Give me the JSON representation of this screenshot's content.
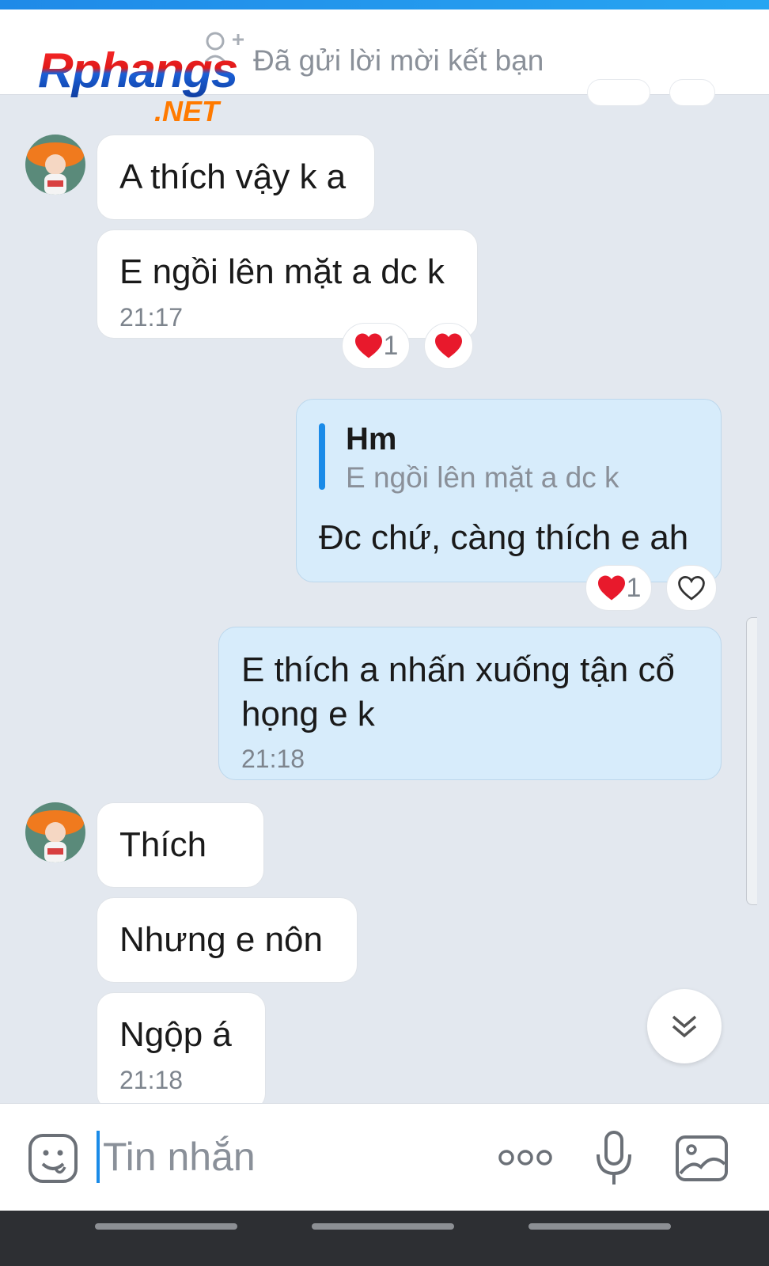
{
  "header": {
    "friend_request_text": "Đã gửi lời mời kết bạn"
  },
  "watermark": {
    "brand": "Rphangs",
    "suffix": ".NET"
  },
  "messages": [
    {
      "sender": "other",
      "text": "A thích vậy k a"
    },
    {
      "sender": "other",
      "text": "E ngồi lên mặt a dc k",
      "time": "21:17",
      "reaction_count": "1"
    },
    {
      "sender": "me",
      "reply_to_name": "Hm",
      "reply_to_text": "E ngồi lên mặt a dc k",
      "text": "Đc chứ, càng thích e ah",
      "reaction_count": "1"
    },
    {
      "sender": "me",
      "text_line1": "E thích a nhấn xuống tận cổ",
      "text_line2": "họng e k",
      "time": "21:18"
    },
    {
      "sender": "other",
      "text": "Thích"
    },
    {
      "sender": "other",
      "text": "Nhưng e nôn"
    },
    {
      "sender": "other",
      "text": "Ngộp á",
      "time": "21:18"
    }
  ],
  "input": {
    "placeholder": "Tin nhắn"
  },
  "icons": {
    "heart_filled": "heart-filled-icon",
    "heart_outline": "heart-outline-icon",
    "scroll_down": "double-chevron-down-icon",
    "emoji": "sticker-icon",
    "more": "more-icon",
    "mic": "microphone-icon",
    "image": "image-icon"
  },
  "colors": {
    "accent": "#1a8be8",
    "heart": "#e8192c",
    "my_bubble": "#d7ecfb",
    "background": "#e3e8ef"
  }
}
